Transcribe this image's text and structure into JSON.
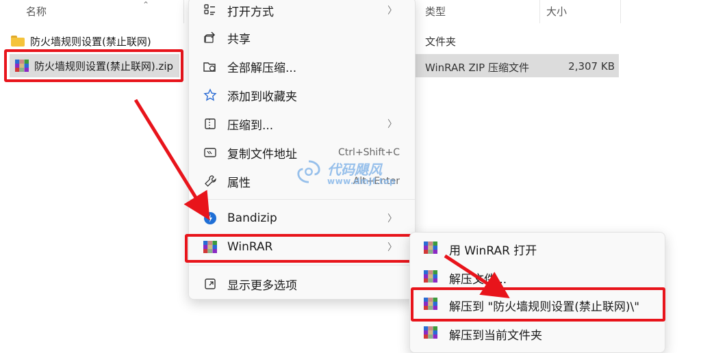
{
  "explorer": {
    "headers": {
      "name": "名称",
      "type": "类型",
      "size": "大小"
    },
    "rows": [
      {
        "name": "防火墙规则设置(禁止联网)",
        "type": "文件夹",
        "size": "",
        "icon": "folder-icon",
        "selected": false
      },
      {
        "name": "防火墙规则设置(禁止联网).zip",
        "type": "WinRAR ZIP 压缩文件",
        "size": "2,307 KB",
        "icon": "winrar-icon",
        "selected": true
      }
    ]
  },
  "context_menu": {
    "items": [
      {
        "label": "打开方式",
        "icon": "open-with-icon",
        "shortcut": "",
        "has_submenu": true
      },
      {
        "label": "共享",
        "icon": "share-icon",
        "shortcut": "",
        "has_submenu": false
      },
      {
        "label": "全部解压缩...",
        "icon": "extract-all-icon",
        "shortcut": "",
        "has_submenu": false
      },
      {
        "label": "添加到收藏夹",
        "icon": "star-icon",
        "shortcut": "",
        "has_submenu": false
      },
      {
        "label": "压缩到...",
        "icon": "compress-icon",
        "shortcut": "",
        "has_submenu": true
      },
      {
        "label": "复制文件地址",
        "icon": "copy-path-icon",
        "shortcut": "Ctrl+Shift+C",
        "has_submenu": false
      },
      {
        "label": "属性",
        "icon": "wrench-icon",
        "shortcut": "Alt+Enter",
        "has_submenu": false
      },
      {
        "label": "Bandizip",
        "icon": "bandizip-icon",
        "shortcut": "",
        "has_submenu": true
      },
      {
        "label": "WinRAR",
        "icon": "winrar-icon",
        "shortcut": "",
        "has_submenu": true
      },
      {
        "label": "显示更多选项",
        "icon": "more-options-icon",
        "shortcut": "",
        "has_submenu": false
      }
    ]
  },
  "winrar_submenu": {
    "items": [
      {
        "label": "用 WinRAR 打开",
        "icon": "winrar-icon"
      },
      {
        "label": "解压文件...",
        "icon": "winrar-icon"
      },
      {
        "label": "解压到 \"防火墙规则设置(禁止联网)\\\"",
        "icon": "winrar-icon",
        "highlighted": true
      },
      {
        "label": "解压到当前文件夹",
        "icon": "winrar-icon"
      }
    ]
  },
  "watermark": {
    "title": "代码飓风",
    "url": "www.dmjf.top"
  },
  "colors": {
    "annotation_red": "#e8141b",
    "selection_bg": "#dcdcdc",
    "menu_bg": "#f9f9f9"
  }
}
